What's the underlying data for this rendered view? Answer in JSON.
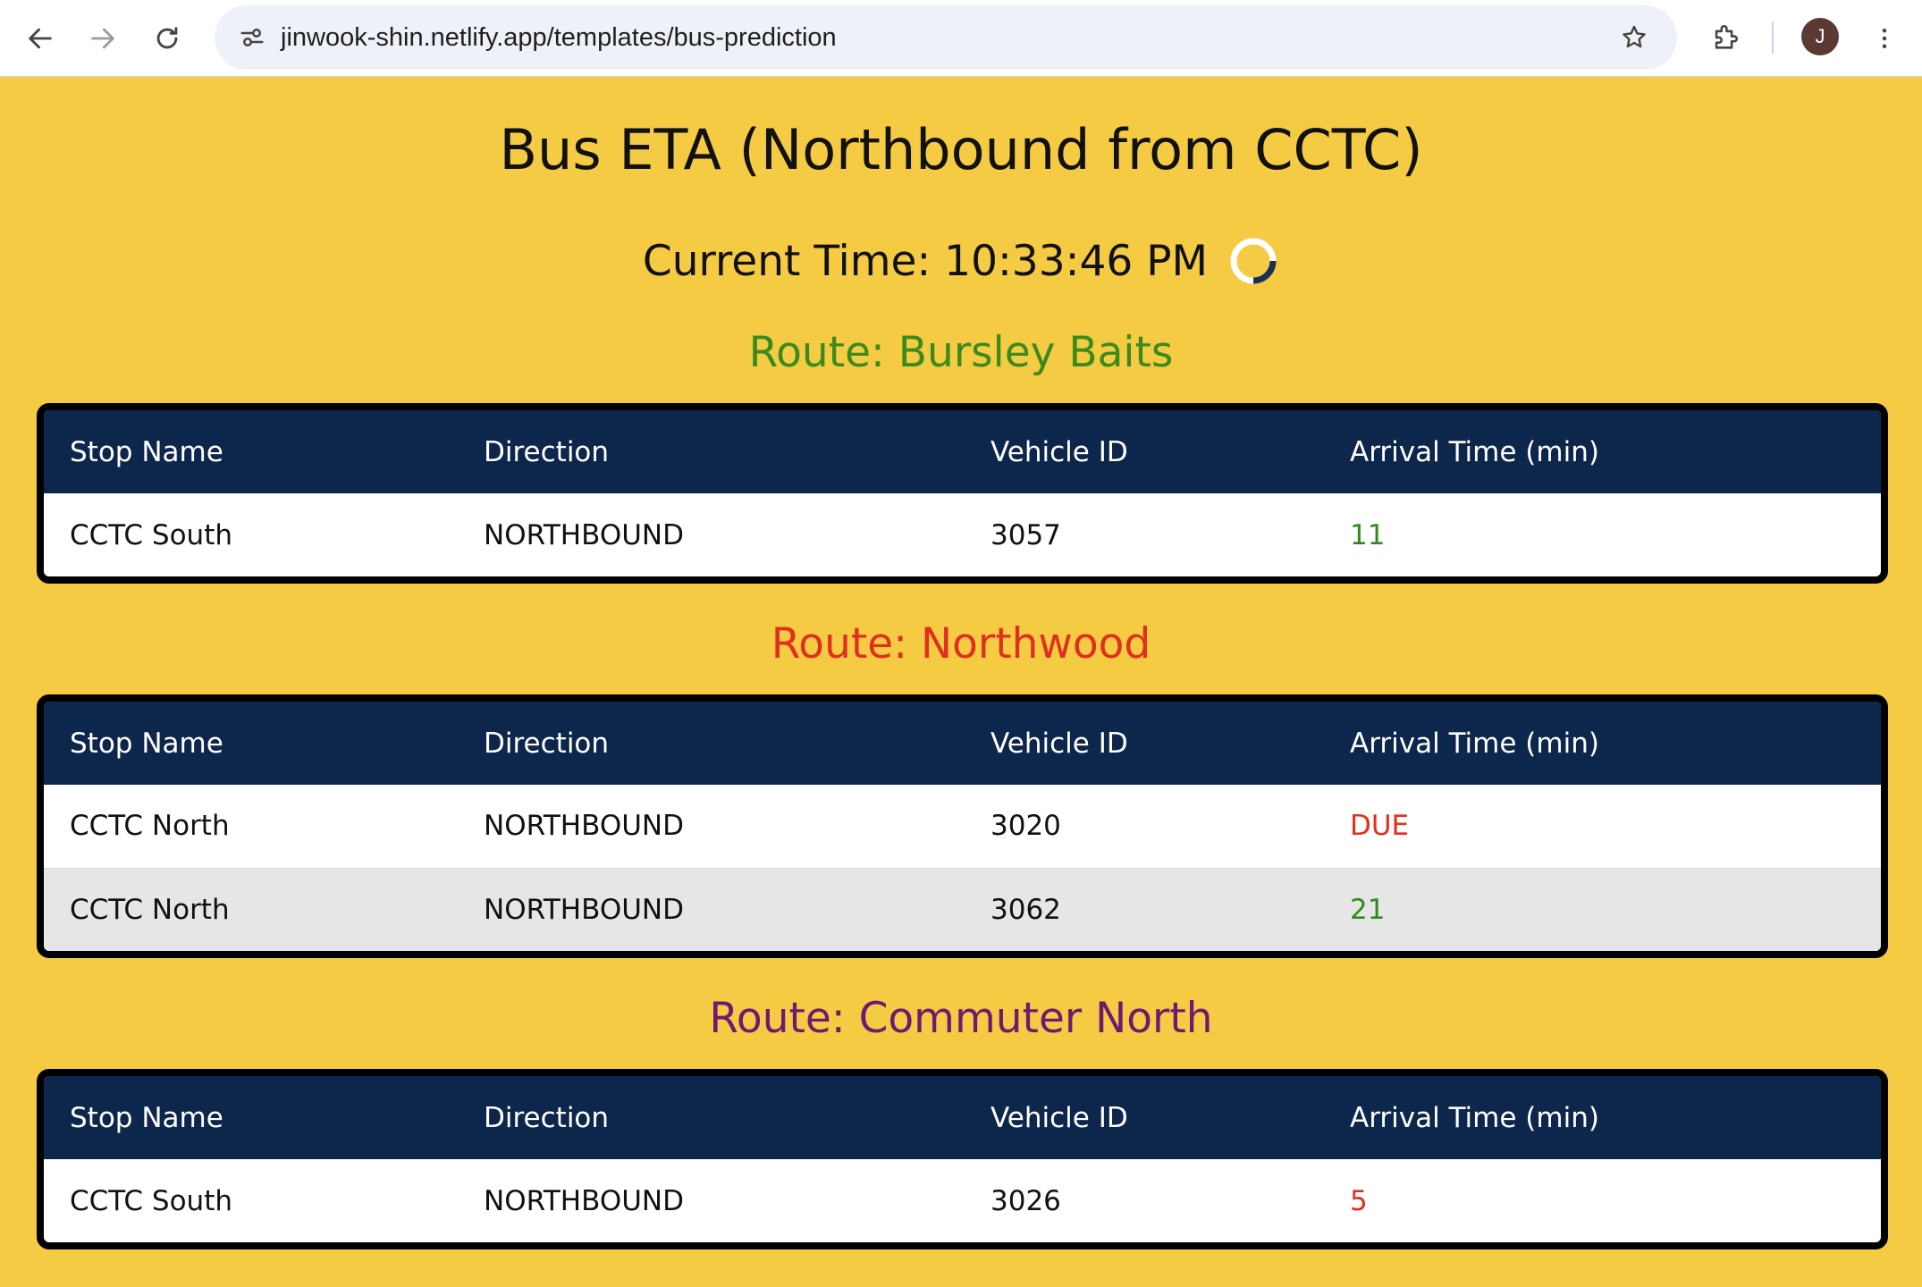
{
  "browser": {
    "url": "jinwook-shin.netlify.app/templates/bus-prediction",
    "profile_initial": "J"
  },
  "page": {
    "title": "Bus ETA (Northbound from CCTC)",
    "current_time_label": "Current Time: 10:33:46 PM"
  },
  "columns": {
    "stop": "Stop Name",
    "direction": "Direction",
    "vehicle": "Vehicle ID",
    "arrival": "Arrival Time (min)"
  },
  "colors": {
    "header_bg": "#0d264b",
    "page_bg": "#f5cb44",
    "route_green": "#3c8a1c",
    "route_red": "#e02f1f",
    "route_purple": "#6e1a70",
    "arrival_green": "#2f8a1c",
    "arrival_red": "#e0301f"
  },
  "routes": [
    {
      "title": "Route: Bursley Baits",
      "color": "#3c8a1c",
      "rows": [
        {
          "stop": "CCTC South",
          "direction": "NORTHBOUND",
          "vehicle": "3057",
          "arrival": "11",
          "arrival_color": "#2f8a1c"
        }
      ]
    },
    {
      "title": "Route: Northwood",
      "color": "#e02f1f",
      "rows": [
        {
          "stop": "CCTC North",
          "direction": "NORTHBOUND",
          "vehicle": "3020",
          "arrival": "DUE",
          "arrival_color": "#e0301f"
        },
        {
          "stop": "CCTC North",
          "direction": "NORTHBOUND",
          "vehicle": "3062",
          "arrival": "21",
          "arrival_color": "#2f8a1c"
        }
      ]
    },
    {
      "title": "Route: Commuter North",
      "color": "#6e1a70",
      "rows": [
        {
          "stop": "CCTC South",
          "direction": "NORTHBOUND",
          "vehicle": "3026",
          "arrival": "5",
          "arrival_color": "#e0301f"
        }
      ]
    }
  ]
}
